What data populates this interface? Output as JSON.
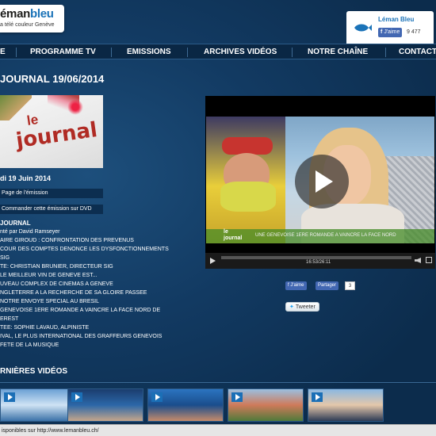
{
  "brand": {
    "logo_word_1": "éman",
    "logo_word_2": "bleu",
    "tagline": "a télé couleur Genève"
  },
  "social_box": {
    "name": "Léman Bleu",
    "like_label": "J'aime",
    "like_count": "9 477"
  },
  "nav": {
    "items": [
      "E",
      "PROGRAMME TV",
      "EMISSIONS",
      "ARCHIVES VIDÉOS",
      "NOTRE CHAÎNE",
      "CONTACT"
    ]
  },
  "page_title": "JOURNAL 19/06/2014",
  "thumbnail": {
    "le": "le",
    "journal": "journal"
  },
  "episode": {
    "date": "di 19 Juin 2014",
    "page_link": "Page de l'émission",
    "dvd_link": "Commander cette émission sur DVD",
    "rundown_heading": "JOURNAL",
    "rundown": [
      "nté par David Ramseyer",
      "AIRE GIROUD : CONFRONTATION DES PREVENUS",
      "COUR DES COMPTES DENONCE LES DYSFONCTIONNEMENTS",
      "SIG",
      "TE: CHRISTIAN BRUNIER, DIRECTEUR SIG",
      "LE MEILLEUR VIN DE GENEVE EST...",
      "UVEAU COMPLEX DE CINEMAS A GENEVE",
      "NGLETERRE A LA RECHERCHE DE SA GLOIRE PASSEE",
      "NOTRE ENVOYE SPECIAL AU BRESIL",
      "GENEVOISE 1ERE ROMANDE A VAINCRE LA FACE NORD DE",
      "EREST",
      "TEE: SOPHIE LAVAUD, ALPINISTE",
      "IVAL, LE PLUS INTERNATIONAL DES GRAFFEURS GENEVOIS",
      "FETE DE LA MUSIQUE"
    ]
  },
  "player": {
    "overlay_logo_1": "le",
    "overlay_logo_2": "journal",
    "ticker": "UNE GENEVOISE 1ERE ROMANDE A VAINCRE LA FACE NORD",
    "time": "16:53/26:11",
    "progress": 0.0
  },
  "share": {
    "fb_like": "J'aime",
    "fb_share": "Partager",
    "fb_count": "3",
    "tweet": "Tweeter"
  },
  "latest": {
    "title": "RNIÈRES VIDÉOS"
  },
  "status_bar": "isponibles sur http://www.lemanbleu.ch/",
  "colors": {
    "accent": "#1b73b8",
    "facebook": "#4267b2",
    "background": "#0f3358"
  }
}
